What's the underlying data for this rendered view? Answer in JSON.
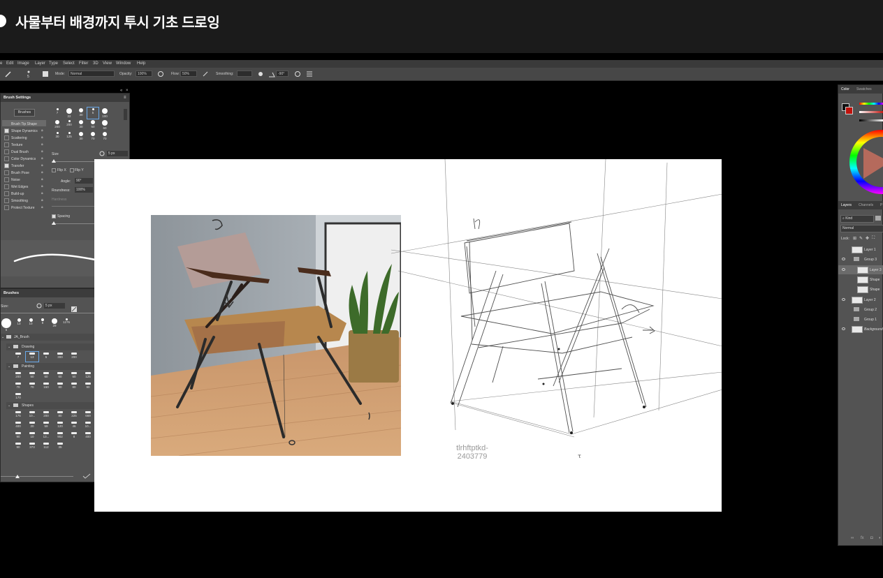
{
  "header": {
    "title": "사물부터 배경까지 투시 기초 드로잉"
  },
  "menubar": [
    "Edit",
    "Image",
    "Layer",
    "Type",
    "Select",
    "Filter",
    "3D",
    "View",
    "Window",
    "Help"
  ],
  "options": {
    "mode_label": "Mode:",
    "mode_value": "Normal",
    "opacity_label": "Opacity:",
    "opacity_value": "100%",
    "flow_label": "Flow:",
    "flow_value": "50%",
    "smoothing_label": "Smoothing:",
    "angle_value": "-90°"
  },
  "brush_settings": {
    "title": "Brush Settings",
    "brushes_button": "Brushes",
    "items": [
      "Brush Tip Shape",
      "Shape Dynamics",
      "Scattering",
      "Texture",
      "Dual Brush",
      "Color Dynamics",
      "Transfer",
      "Brush Pose",
      "Noise",
      "Wet Edges",
      "Build-up",
      "Smoothing",
      "Protect Texture"
    ],
    "checked": [
      false,
      true,
      false,
      false,
      false,
      false,
      true,
      false,
      false,
      false,
      false,
      false,
      false
    ],
    "size_label": "Size",
    "size_value": "5 px",
    "flip_x": "Flip X",
    "flip_y": "Flip Y",
    "angle_label": "Angle:",
    "angle_value": "90°",
    "roundness_label": "Roundness:",
    "roundness_value": "100%",
    "hardness_label": "Hardness",
    "spacing_label": "Spacing",
    "spacing_value": "4%",
    "tip_sizes_row1": [
      "7",
      "22",
      "30",
      "5",
      "100"
    ],
    "tip_sizes_row2": [
      "200",
      "200",
      "30",
      "50",
      "60"
    ],
    "tip_sizes_row3": [
      "30",
      "125",
      "30",
      "70",
      "70"
    ]
  },
  "brushes_panel": {
    "title": "Brushes",
    "size_label": "Size:",
    "size_value": "5 px",
    "preset_sizes": [
      "5",
      "13",
      "10",
      "8",
      "29",
      "1276"
    ],
    "root_folder": "JA_Brush",
    "group_drawing": "Drawing",
    "drawing_sizes": [
      "7",
      "13",
      "5",
      "300",
      "200"
    ],
    "group_painting": "Painting",
    "painting_sizes_row1": [
      "200",
      "50",
      "60",
      "60",
      "50",
      "125",
      "50"
    ],
    "painting_sizes_row2": [
      "70",
      "70",
      "150",
      "80",
      "80",
      "90"
    ],
    "painting_sizes_row3": [
      "170"
    ],
    "group_shapes": "Shapes",
    "shapes_row1": [
      "175",
      "10...",
      "200",
      "80",
      "225",
      "669"
    ],
    "shapes_row2": [
      "400",
      "20",
      "59",
      "120",
      "46",
      "10...",
      "640"
    ],
    "shapes_row3": [
      "90",
      "10",
      "13...",
      "902",
      "8",
      "400",
      "17..."
    ],
    "shapes_row4": [
      "90",
      "373",
      "112",
      "35"
    ]
  },
  "canvas": {
    "watermark_line1": "tlrhftptkd-",
    "watermark_line2": "2403779"
  },
  "right_panel": {
    "tab_color": "Color",
    "tab_swatches": "Swatches",
    "tab_layers": "Layers",
    "tab_channels": "Channels",
    "tab_paths": "P",
    "kind_label": "Kind",
    "blend_mode": "Normal",
    "lock_label": "Lock:",
    "layers": [
      "Layer 1",
      "Group 3",
      "Layer 3",
      "Shape",
      "Shape",
      "Layer 2",
      "Group 2",
      "Group 1",
      "Background"
    ]
  }
}
